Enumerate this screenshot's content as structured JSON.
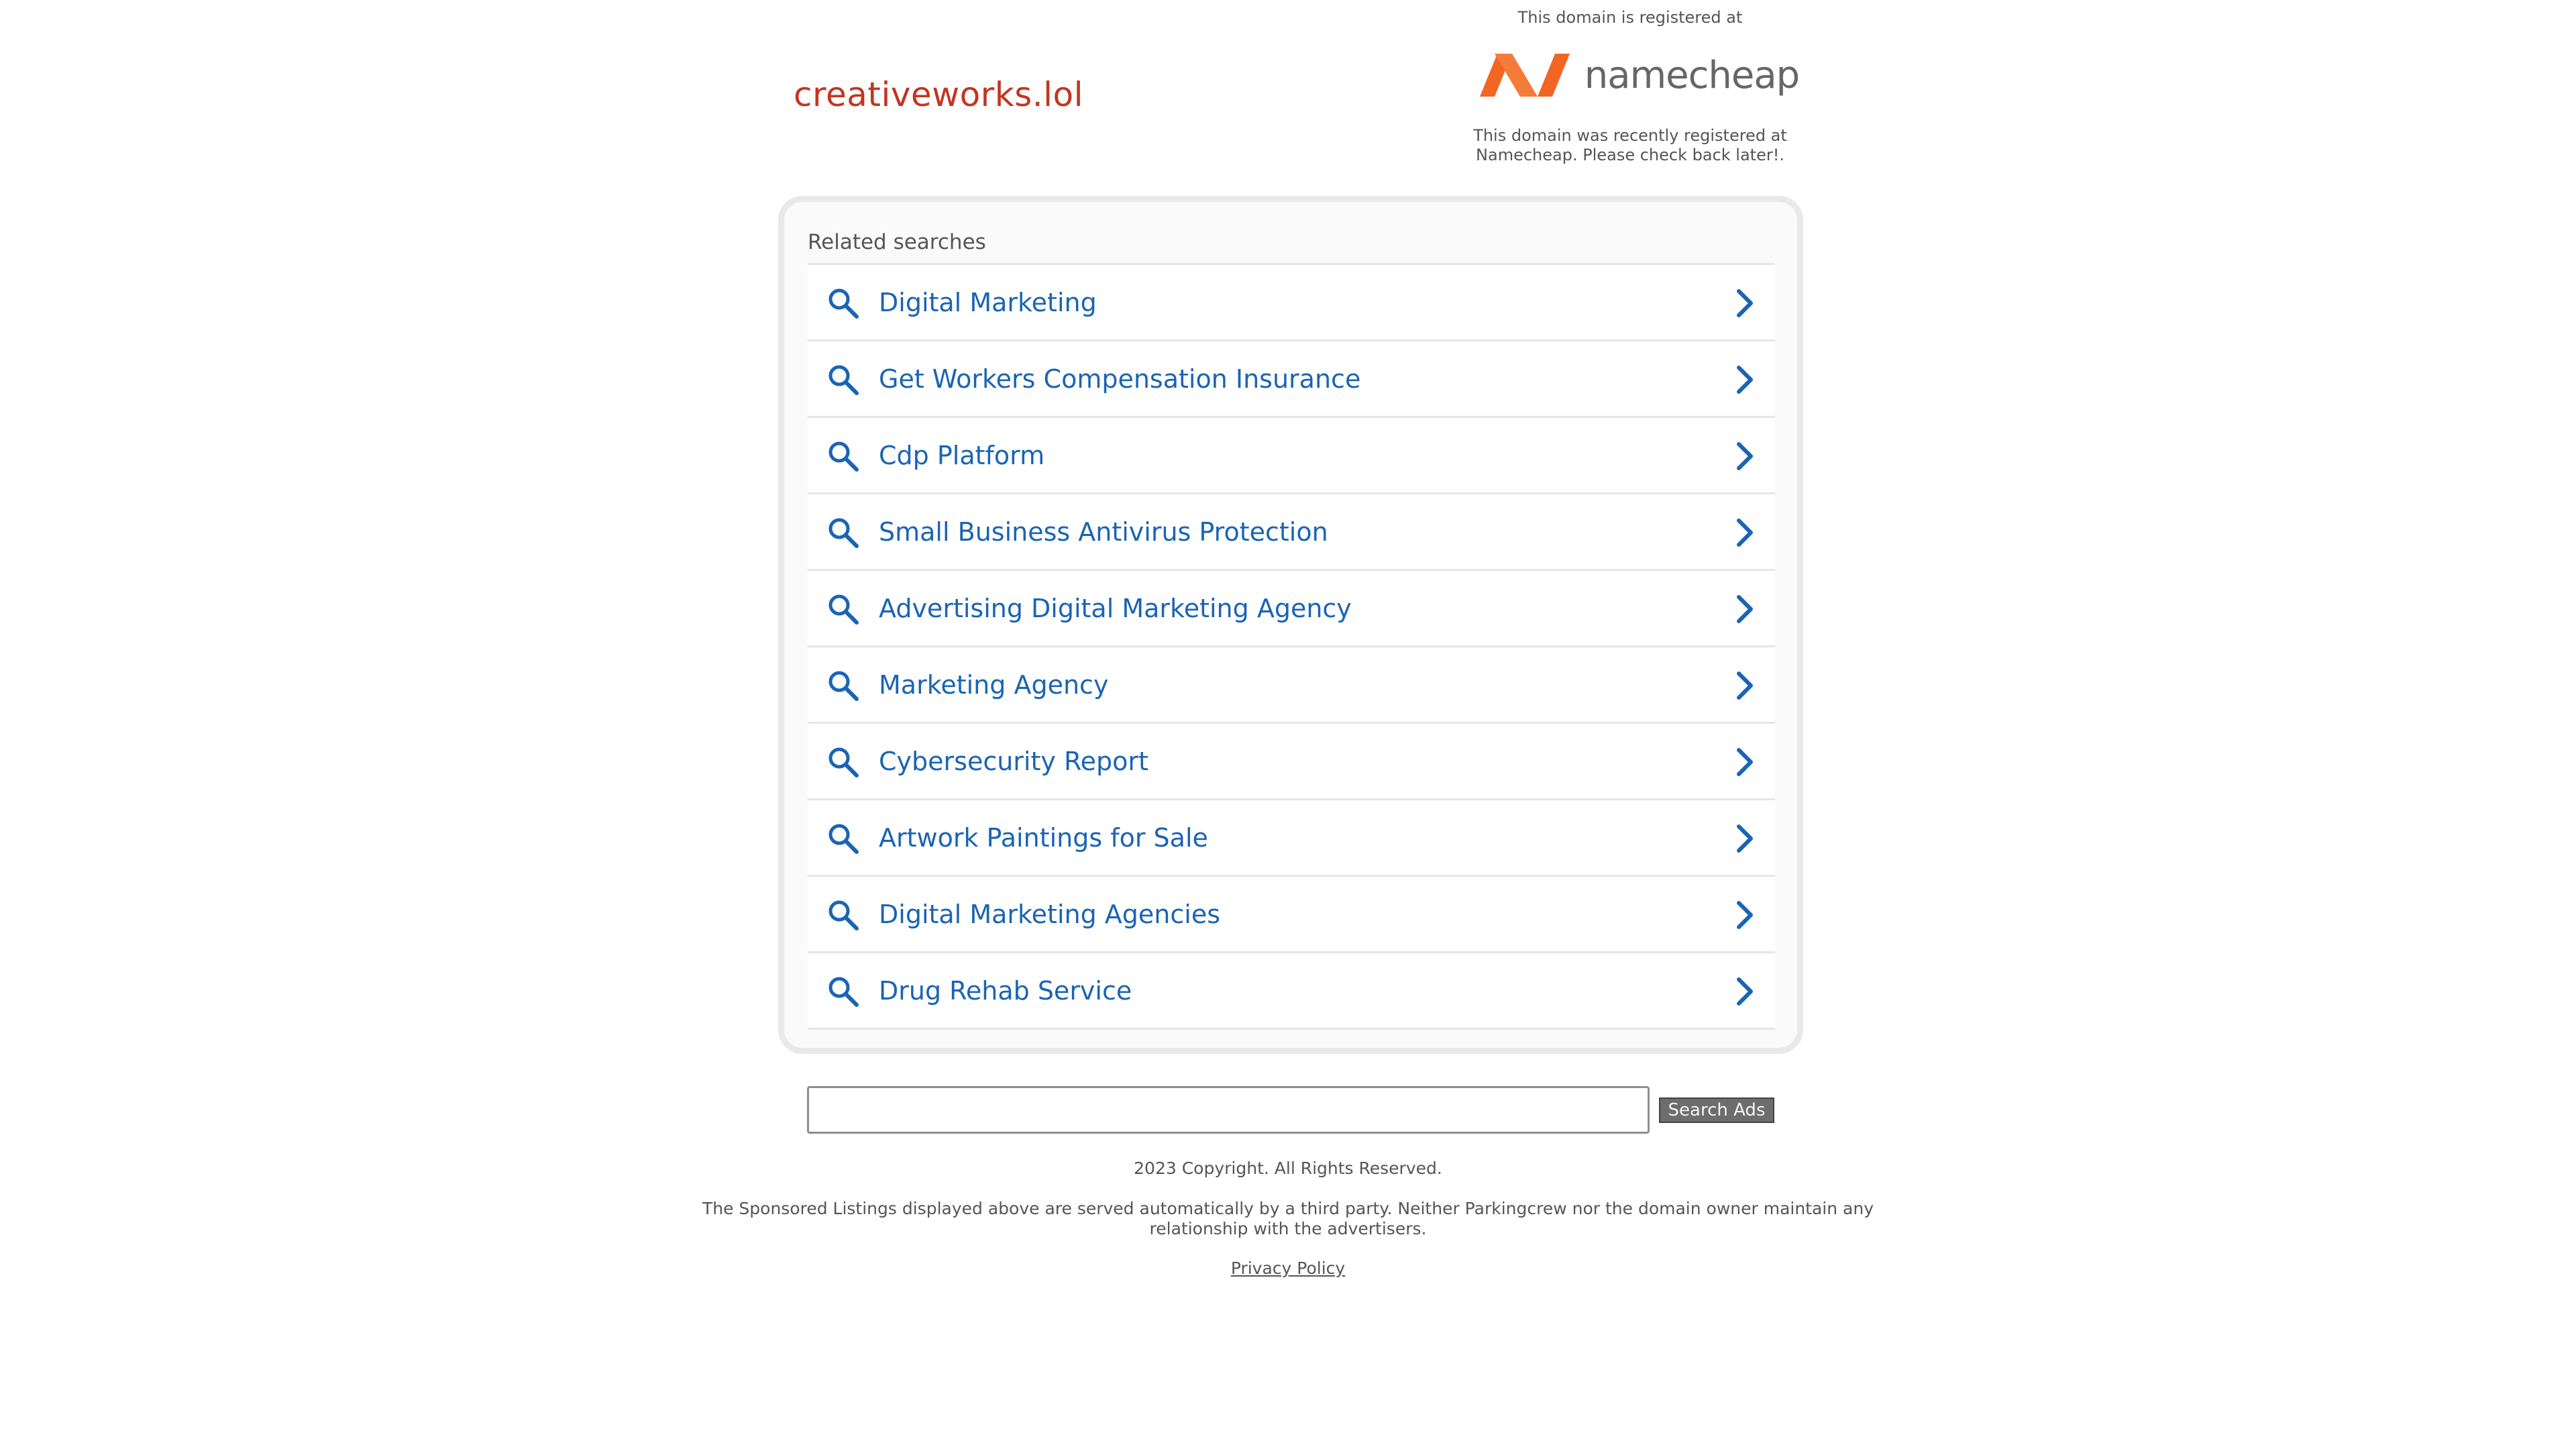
{
  "header": {
    "domain_name": "creativeworks.lol",
    "registrar_intro": "This domain is registered at",
    "registrar_logo_text": "namecheap",
    "registrar_note": "This domain was recently registered at Namecheap. Please check back later!."
  },
  "related": {
    "title": "Related searches",
    "items": [
      {
        "label": "Digital Marketing"
      },
      {
        "label": "Get Workers Compensation Insurance"
      },
      {
        "label": "Cdp Platform"
      },
      {
        "label": "Small Business Antivirus Protection"
      },
      {
        "label": "Advertising Digital Marketing Agency"
      },
      {
        "label": "Marketing Agency"
      },
      {
        "label": "Cybersecurity Report"
      },
      {
        "label": "Artwork Paintings for Sale"
      },
      {
        "label": "Digital Marketing Agencies"
      },
      {
        "label": "Drug Rehab Service"
      }
    ]
  },
  "search": {
    "value": "",
    "button_label": "Search Ads"
  },
  "footer": {
    "copyright": "2023 Copyright. All Rights Reserved.",
    "disclaimer": "The Sponsored Listings displayed above are served automatically by a third party. Neither Parkingcrew nor the domain owner maintain any relationship with the advertisers.",
    "privacy_label": "Privacy Policy"
  },
  "colors": {
    "domain_title": "#c4341f",
    "result_link": "#1a64b4",
    "logo_orange": "#f26522"
  },
  "icons": {
    "result_leading": "search-icon",
    "result_trailing": "chevron-right-icon",
    "registrar_logo": "namecheap-logo-icon"
  }
}
